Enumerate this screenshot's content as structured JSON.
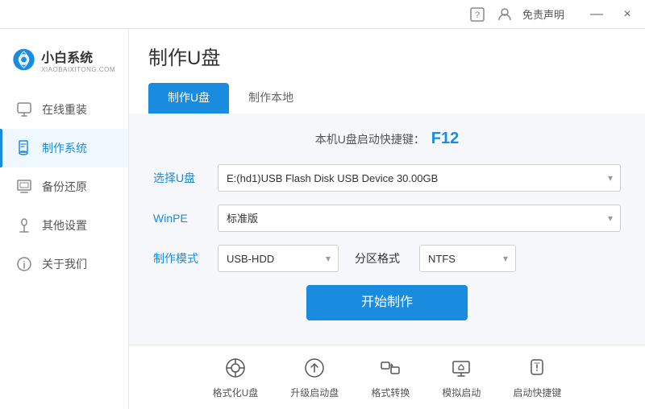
{
  "titlebar": {
    "free_label": "免责声明",
    "minimize_label": "—",
    "close_label": "×"
  },
  "logo": {
    "title": "小白系统",
    "subtitle": "XIAOBAIXITONG.COM"
  },
  "sidebar": {
    "items": [
      {
        "id": "online-reinstall",
        "label": "在线重装",
        "icon": "🖥"
      },
      {
        "id": "make-system",
        "label": "制作系统",
        "icon": "💾",
        "active": true
      },
      {
        "id": "backup-restore",
        "label": "备份还原",
        "icon": "📋"
      },
      {
        "id": "other-settings",
        "label": "其他设置",
        "icon": "🔒"
      },
      {
        "id": "about-us",
        "label": "关于我们",
        "icon": "ℹ"
      }
    ]
  },
  "page": {
    "title": "制作U盘",
    "tabs": [
      {
        "id": "make-usb",
        "label": "制作U盘",
        "active": true
      },
      {
        "id": "make-local",
        "label": "制作本地"
      }
    ]
  },
  "form": {
    "shortcut_prefix": "本机U盘启动快捷键：",
    "shortcut_key": "F12",
    "fields": {
      "select_usb_label": "选择U盘",
      "select_usb_value": "E:(hd1)USB Flash Disk USB Device 30.00GB",
      "winpe_label": "WinPE",
      "winpe_value": "标准版",
      "mode_label": "制作模式",
      "mode_value": "USB-HDD",
      "partition_label": "分区格式",
      "partition_value": "NTFS"
    },
    "start_button": "开始制作"
  },
  "bottom_toolbar": {
    "items": [
      {
        "id": "format-usb",
        "label": "格式化U盘",
        "icon": "⊙"
      },
      {
        "id": "upgrade-boot",
        "label": "升级启动盘",
        "icon": "⊕"
      },
      {
        "id": "format-convert",
        "label": "格式转换",
        "icon": "⇄"
      },
      {
        "id": "simulate-boot",
        "label": "模拟启动",
        "icon": "⊞"
      },
      {
        "id": "boot-shortcut",
        "label": "启动快捷键",
        "icon": "🔒"
      }
    ]
  }
}
